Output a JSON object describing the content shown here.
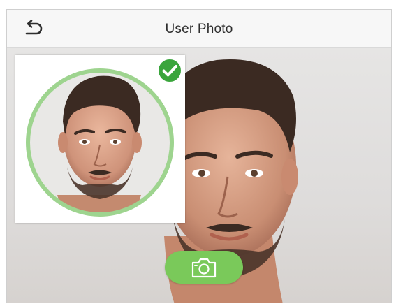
{
  "header": {
    "title": "User Photo",
    "back_icon": "back-arrow-icon"
  },
  "captured_photo": {
    "status_icon": "check-badge-icon",
    "status_color": "#3aa53c",
    "ring_color": "#9ed48f"
  },
  "camera": {
    "shutter_icon": "camera-icon",
    "shutter_color": "#7ac95a"
  }
}
